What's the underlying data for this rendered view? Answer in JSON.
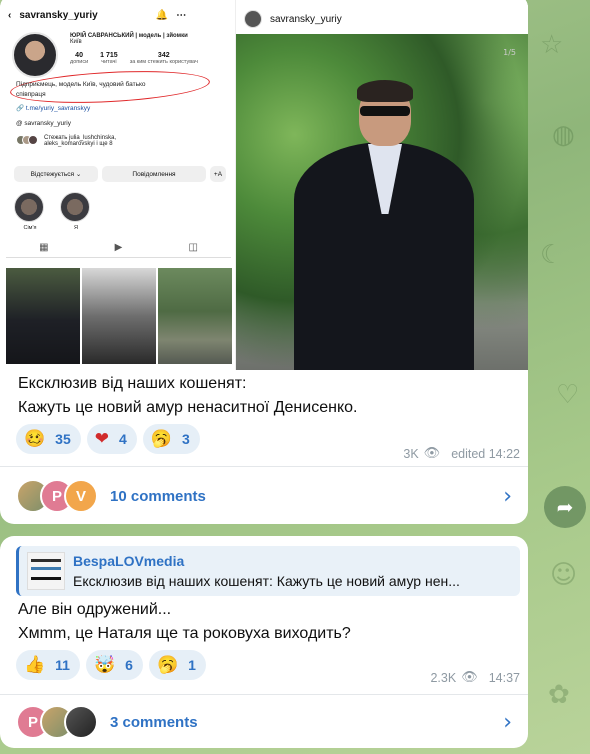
{
  "post1": {
    "screenshot_left": {
      "username": "savransky_yuriy",
      "display_name": "ЮРІЙ САВРАНСЬКИЙ | модель | зйомки",
      "city": "Київ",
      "stats": [
        {
          "value": "40",
          "label": "дописи"
        },
        {
          "value": "1 715",
          "label": "читачі"
        },
        {
          "value": "342",
          "label": "за ким стежить користувач"
        }
      ],
      "bio_line1": "Підприємець, модель Київ, чудовий батько",
      "bio_line2": "співпраця",
      "link": "t.me/yuriy_savranskyy",
      "threads": "savransky_yuriy",
      "followed_by": "Стежать julia_lushchinska,",
      "followed_by2": "aleks_komarovskyi і ще 8",
      "btn_following": "Відстежується ⌄",
      "btn_message": "Повідомлення",
      "btn_add": "+A",
      "highlights": [
        "Сім'я",
        "Я"
      ]
    },
    "screenshot_right": {
      "username": "savransky_yuriy",
      "pager": "1/5"
    },
    "text_line1": "Ексклюзив від наших кошенят:",
    "text_line2": "Кажуть це новий амур ненаситної Денисенко.",
    "reactions": [
      {
        "emoji": "🥴",
        "count": "35"
      },
      {
        "emoji": "❤",
        "count": "4"
      },
      {
        "emoji": "🥱",
        "count": "3"
      }
    ],
    "views": "3K",
    "edited": "edited 14:22",
    "comments_label": "10 comments",
    "comment_avatars": [
      "",
      "P",
      "V"
    ]
  },
  "post2": {
    "reply_name": "BespaLOVmedia",
    "reply_text": "Ексклюзив від наших кошенят: Кажуть це новий амур нен...",
    "text_line1": "Але він одружений...",
    "text_line2": "Хмmm, це Наталя ще та роковуха виходить?",
    "reactions": [
      {
        "emoji": "👍",
        "count": "11"
      },
      {
        "emoji": "🤯",
        "count": "6"
      },
      {
        "emoji": "🥱",
        "count": "1"
      }
    ],
    "views": "2.3K",
    "time": "14:37",
    "comments_label": "3 comments",
    "comment_avatars": [
      "P",
      "",
      ""
    ]
  },
  "colors": {
    "accent": "#2f72c4",
    "reaction_bg": "#e6eff7",
    "bio_circle": "#e0282a"
  }
}
